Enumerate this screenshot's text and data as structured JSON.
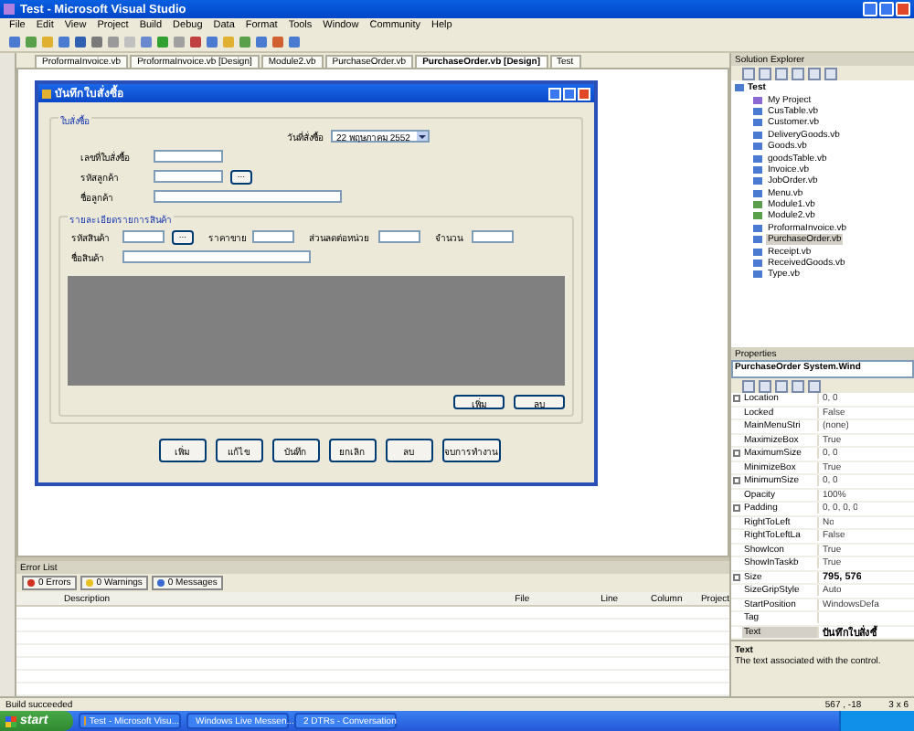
{
  "window": {
    "title": "Test - Microsoft Visual Studio"
  },
  "menu": [
    "File",
    "Edit",
    "View",
    "Project",
    "Build",
    "Debug",
    "Data",
    "Format",
    "Tools",
    "Window",
    "Community",
    "Help"
  ],
  "doc_tabs": [
    {
      "label": "ProformaInvoice.vb",
      "selected": false
    },
    {
      "label": "ProformaInvoice.vb [Design]",
      "selected": false
    },
    {
      "label": "Module2.vb",
      "selected": false
    },
    {
      "label": "PurchaseOrder.vb",
      "selected": false
    },
    {
      "label": "PurchaseOrder.vb [Design]",
      "selected": true
    },
    {
      "label": "Test",
      "selected": false
    }
  ],
  "form": {
    "title": "บันทึกใบสั่งซื้อ",
    "order_group": {
      "title": "ใบสั่งซื้อ",
      "date_label": "วันที่สั่งซื้อ",
      "date_value": "22  พฤษภาคม   2552",
      "order_no_label": "เลขที่ใบสั่งซื้อ",
      "customer_id_label": "รหัสลูกค้า",
      "browse": "...",
      "customer_name_label": "ชื่อลูกค้า"
    },
    "items_group": {
      "title": "รายละเอียดรายการสินค้า",
      "product_id_label": "รหัสสินค้า",
      "browse": "...",
      "price_label": "ราคาขาย",
      "discount_label": "ส่วนลดต่อหน่วย",
      "qty_label": "จำนวน",
      "product_name_label": "ชื่อสินค้า",
      "buttons": [
        "เพิ่ม",
        "ลบ"
      ]
    },
    "buttons": [
      "เพิ่ม",
      "แก้ไข",
      "บันทึก",
      "ยกเลิก",
      "ลบ",
      "จบการทำงาน"
    ]
  },
  "error_list": {
    "title": "Error List",
    "filters": [
      {
        "label": "0 Errors",
        "kind": "error"
      },
      {
        "label": "0 Warnings",
        "kind": "warning"
      },
      {
        "label": "0 Messages",
        "kind": "info"
      }
    ],
    "columns": [
      "Description",
      "File",
      "Line",
      "Column",
      "Project"
    ]
  },
  "solution_explorer": {
    "title": "Solution Explorer",
    "root": "Test",
    "items": [
      {
        "label": "My Project",
        "kind": "project",
        "selected": false
      },
      {
        "label": "CusTable.vb",
        "kind": "form",
        "selected": false
      },
      {
        "label": "Customer.vb",
        "kind": "form",
        "selected": false
      },
      {
        "label": "DeliveryGoods.vb",
        "kind": "form",
        "selected": false
      },
      {
        "label": "Goods.vb",
        "kind": "form",
        "selected": false
      },
      {
        "label": "goodsTable.vb",
        "kind": "form",
        "selected": false
      },
      {
        "label": "Invoice.vb",
        "kind": "form",
        "selected": false
      },
      {
        "label": "JobOrder.vb",
        "kind": "form",
        "selected": false
      },
      {
        "label": "Menu.vb",
        "kind": "form",
        "selected": false
      },
      {
        "label": "Module1.vb",
        "kind": "module",
        "selected": false
      },
      {
        "label": "Module2.vb",
        "kind": "module",
        "selected": false
      },
      {
        "label": "ProformaInvoice.vb",
        "kind": "form",
        "selected": false
      },
      {
        "label": "PurchaseOrder.vb",
        "kind": "form",
        "selected": true
      },
      {
        "label": "Receipt.vb",
        "kind": "form",
        "selected": false
      },
      {
        "label": "ReceivedGoods.vb",
        "kind": "form",
        "selected": false
      },
      {
        "label": "Type.vb",
        "kind": "form",
        "selected": false
      }
    ]
  },
  "properties": {
    "title": "Properties",
    "object": "PurchaseOrder System.Wind",
    "rows": [
      {
        "name": "Location",
        "value": "0, 0",
        "expandable": true,
        "bold": false,
        "selected": false
      },
      {
        "name": "Locked",
        "value": "False",
        "expandable": false,
        "bold": false,
        "selected": false
      },
      {
        "name": "MainMenuStri",
        "value": "(none)",
        "expandable": false,
        "bold": false,
        "selected": false
      },
      {
        "name": "MaximizeBox",
        "value": "True",
        "expandable": false,
        "bold": false,
        "selected": false
      },
      {
        "name": "MaximumSize",
        "value": "0, 0",
        "expandable": true,
        "bold": false,
        "selected": false
      },
      {
        "name": "MinimizeBox",
        "value": "True",
        "expandable": false,
        "bold": false,
        "selected": false
      },
      {
        "name": "MinimumSize",
        "value": "0, 0",
        "expandable": true,
        "bold": false,
        "selected": false
      },
      {
        "name": "Opacity",
        "value": "100%",
        "expandable": false,
        "bold": false,
        "selected": false
      },
      {
        "name": "Padding",
        "value": "0, 0, 0, 0",
        "expandable": true,
        "bold": false,
        "selected": false
      },
      {
        "name": "RightToLeft",
        "value": "No",
        "expandable": false,
        "bold": false,
        "selected": false
      },
      {
        "name": "RightToLeftLa",
        "value": "False",
        "expandable": false,
        "bold": false,
        "selected": false
      },
      {
        "name": "ShowIcon",
        "value": "True",
        "expandable": false,
        "bold": false,
        "selected": false
      },
      {
        "name": "ShowInTaskb",
        "value": "True",
        "expandable": false,
        "bold": false,
        "selected": false
      },
      {
        "name": "Size",
        "value": "795, 576",
        "expandable": true,
        "bold": true,
        "selected": false
      },
      {
        "name": "SizeGripStyle",
        "value": "Auto",
        "expandable": false,
        "bold": false,
        "selected": false
      },
      {
        "name": "StartPosition",
        "value": "WindowsDefa",
        "expandable": false,
        "bold": false,
        "selected": false
      },
      {
        "name": "Tag",
        "expandable": false,
        "selected": false
      },
      {
        "name": "Text",
        "value": "บันทึกใบสั่งซื้",
        "expandable": false,
        "bold": true,
        "selected": true
      }
    ],
    "help_title": "Text",
    "help_text": "The text associated with the control."
  },
  "status_bar": {
    "message": "Build succeeded",
    "position": "567 , -18",
    "size": "3 x 6"
  },
  "taskbar": {
    "start": "start",
    "tasks": [
      "Test - Microsoft Visu...",
      "Windows Live Messen...",
      "2 DTRs - Conversation"
    ]
  }
}
